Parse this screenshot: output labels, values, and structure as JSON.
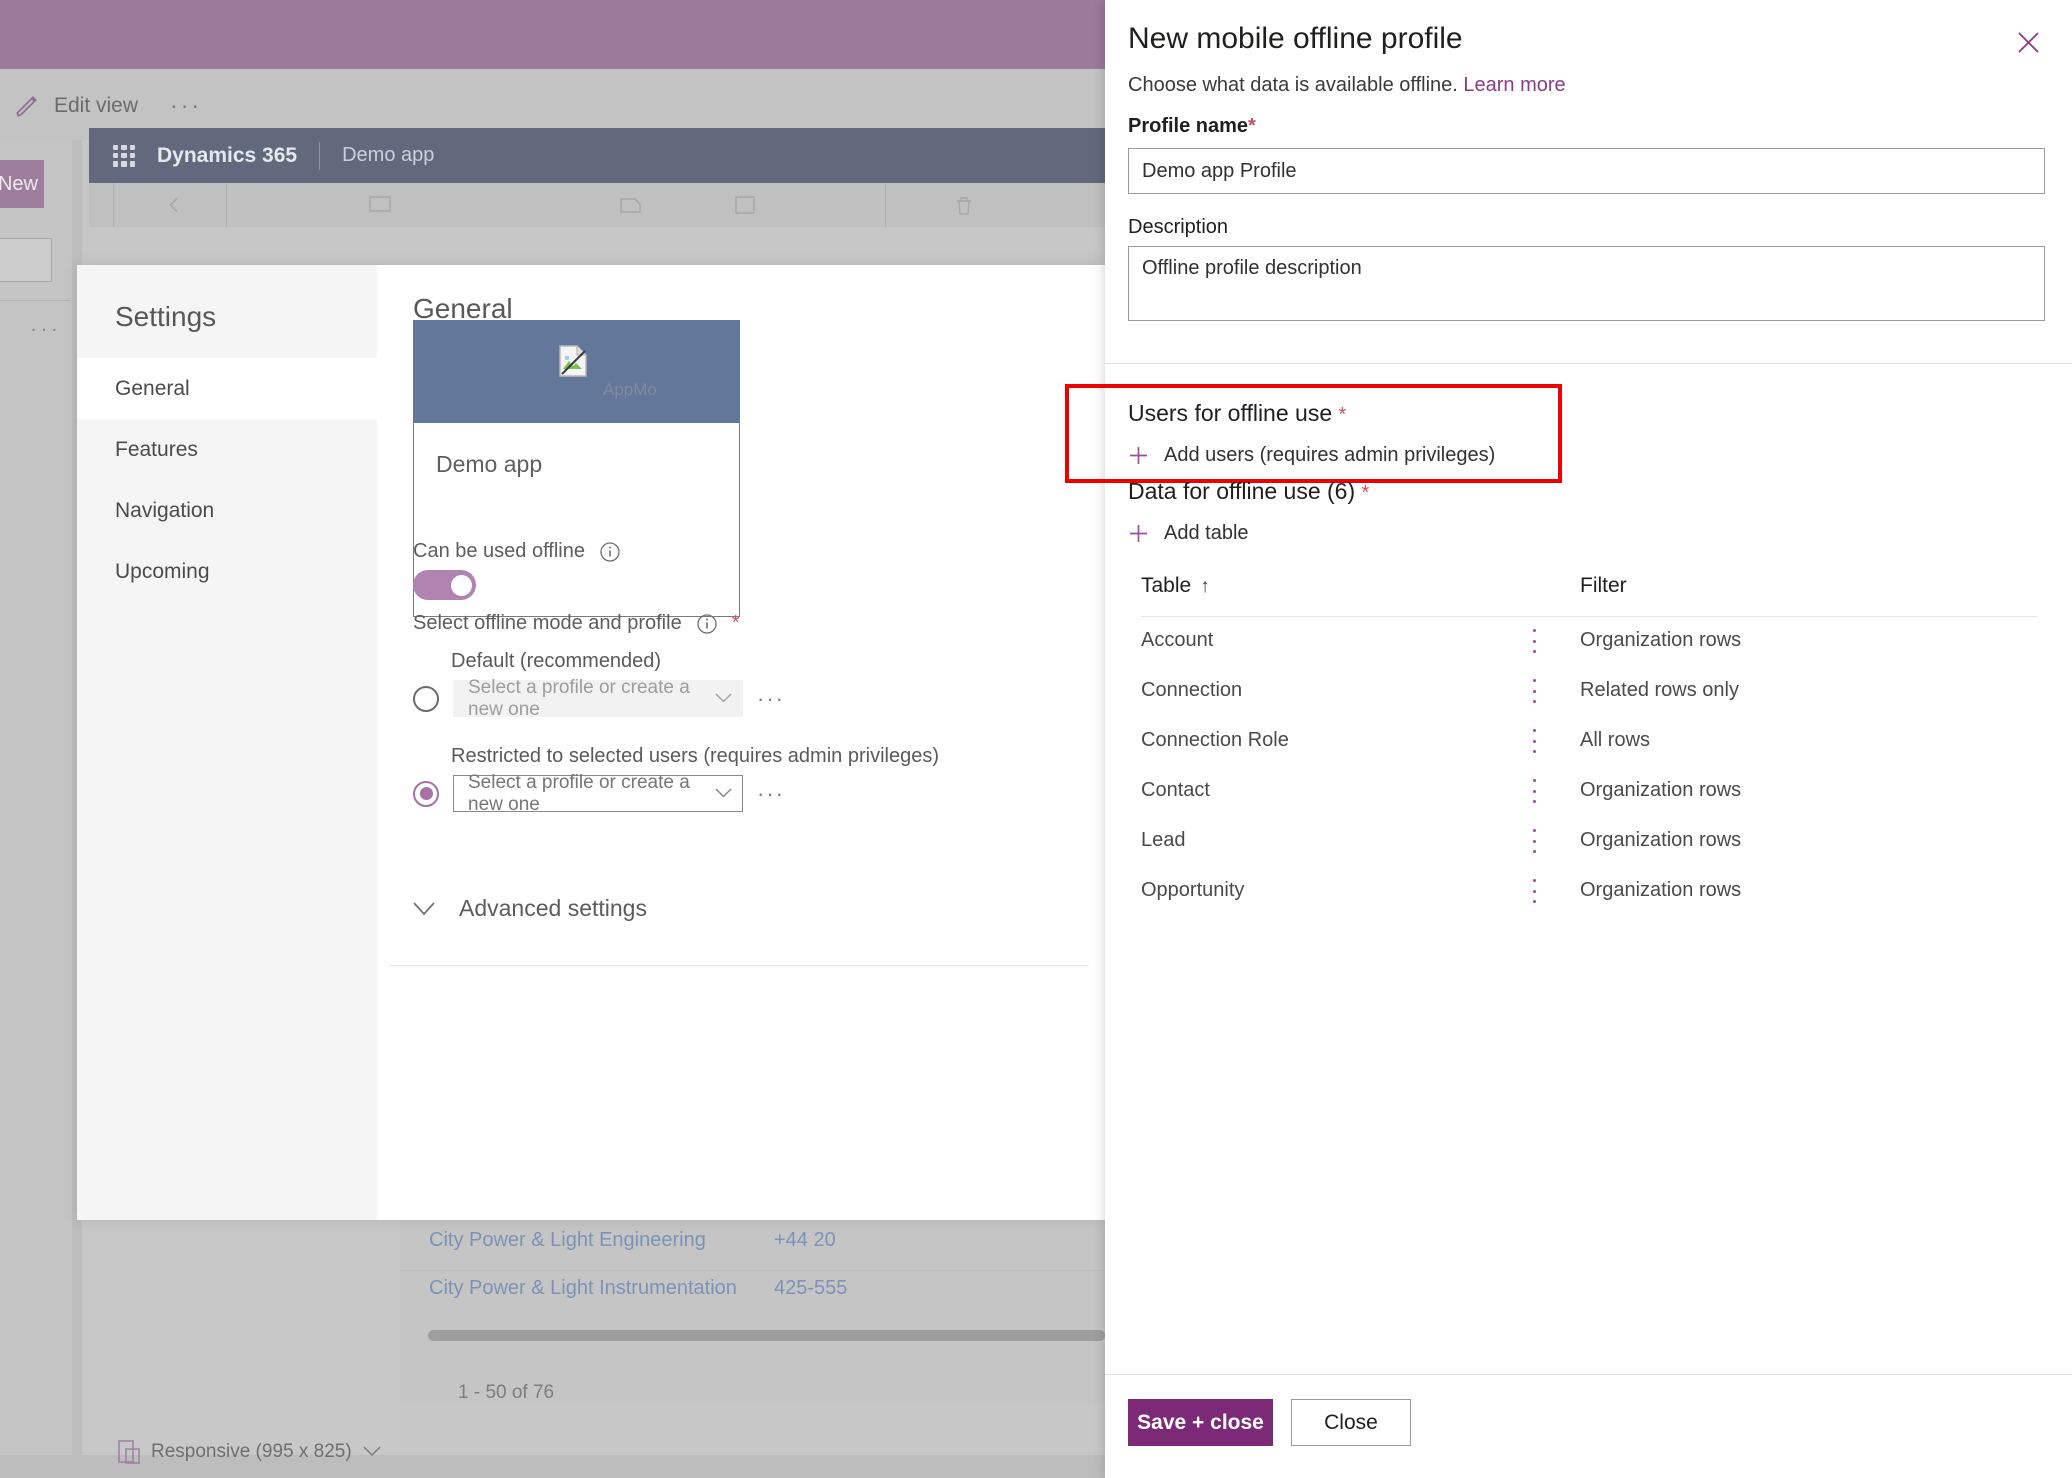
{
  "background": {
    "command_bar": {
      "edit_view_label": "Edit view",
      "overflow_label": "···"
    },
    "left_rail": {
      "new_button_label": "New",
      "overflow_label": "···"
    },
    "d365_bar": {
      "product": "Dynamics 365",
      "app_name": "Demo app"
    },
    "grid": {
      "rows": [
        {
          "name": "City Power & Light Engineering",
          "phone": "+44 20"
        },
        {
          "name": "City Power & Light Instrumentation",
          "phone": "425-555"
        }
      ],
      "record_count": "1 - 50 of 76"
    },
    "status_bar": {
      "responsive_label": "Responsive (995 x 825)"
    }
  },
  "settings_flyout": {
    "title": "Settings",
    "nav_items": [
      {
        "label": "General",
        "active": true
      },
      {
        "label": "Features",
        "active": false
      },
      {
        "label": "Navigation",
        "active": false
      },
      {
        "label": "Upcoming",
        "active": false
      }
    ],
    "content": {
      "heading": "General",
      "thumbnail_caption": "AppMo",
      "app_name": "Demo app",
      "offline_toggle_label": "Can be used offline",
      "offline_toggle_state": "on",
      "mode_label": "Select offline mode and profile",
      "mode_required": "*",
      "options": [
        {
          "label": "Default (recommended)",
          "selected": false,
          "combo_value": "Select a profile or create a new one",
          "overflow_label": "···"
        },
        {
          "label": "Restricted to selected users (requires admin privileges)",
          "selected": true,
          "combo_value": "Select a profile or create a new one",
          "overflow_label": "···"
        }
      ],
      "advanced_settings_label": "Advanced settings"
    }
  },
  "side_panel": {
    "title": "New mobile offline profile",
    "close_label": "✕",
    "subtitle_text": "Choose what data is available offline.",
    "learn_more_label": "Learn more",
    "profile_name": {
      "label": "Profile name",
      "required": "*",
      "value": "Demo app Profile"
    },
    "description": {
      "label": "Description",
      "value": "Offline profile description"
    },
    "users_section": {
      "title": "Users for offline use",
      "required": "*",
      "add_label": "Add users (requires admin privileges)"
    },
    "data_section": {
      "title": "Data for offline use (6)",
      "required": "*",
      "add_label": "Add table"
    },
    "table": {
      "columns": [
        "Table",
        "Filter"
      ],
      "sort_indicator": "↑",
      "rows": [
        {
          "name": "Account",
          "filter": "Organization rows"
        },
        {
          "name": "Connection",
          "filter": "Related rows only"
        },
        {
          "name": "Connection Role",
          "filter": "All rows"
        },
        {
          "name": "Contact",
          "filter": "Organization rows"
        },
        {
          "name": "Lead",
          "filter": "Organization rows"
        },
        {
          "name": "Opportunity",
          "filter": "Organization rows"
        }
      ]
    },
    "footer": {
      "save_label": "Save + close",
      "close_label": "Close"
    }
  },
  "colors": {
    "accent_purple": "#7c2a78",
    "toggle_on": "#b183b1",
    "highlight_red": "#ee0000",
    "required_star": "#c94f60",
    "link_blue": "#7c93b8",
    "d365_bar": "#63697c"
  }
}
